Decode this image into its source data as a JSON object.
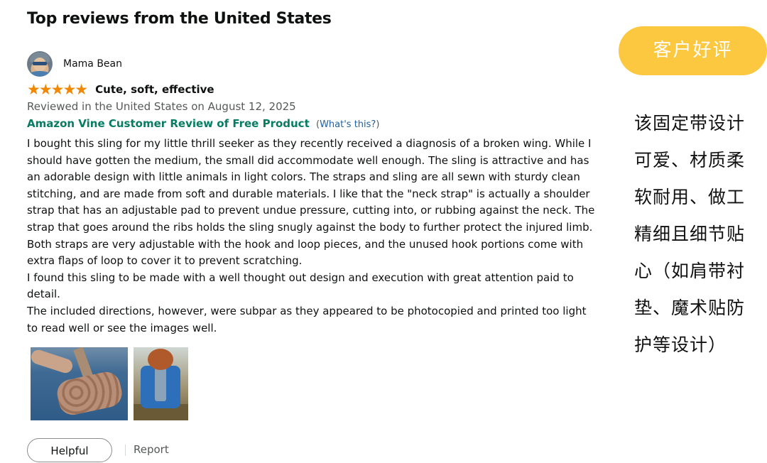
{
  "section_title": "Top reviews from the United States",
  "review": {
    "reviewer_name": "Mama Bean",
    "rating": 5,
    "stars": "★★★★★",
    "title": "Cute, soft, effective",
    "date_line": "Reviewed in the United States on August 12, 2025",
    "vine_label": "Amazon Vine Customer Review of Free Product",
    "whats_this_open": "(",
    "whats_this": "What's this?",
    "whats_this_close": ")",
    "paragraphs": [
      "I bought this sling for my little thrill seeker as they recently received a diagnosis of a broken wing. While I should have gotten the medium, the small did accommodate well enough. The sling is attractive and has an adorable design with little animals in light colors. The straps and sling are all sewn with sturdy clean stitching, and are made from soft and durable materials. I like that the \"neck strap\" is actually a shoulder strap that has an adjustable pad to prevent undue pressure, cutting into, or rubbing against the neck. The strap that goes around the ribs holds the sling snugly against the body to further protect the injured limb. Both straps are very adjustable with the hook and loop pieces, and the unused hook portions come with extra flaps of loop to cover it to prevent scratching.",
      "I found this sling to be made with a well thought out design and execution with great attention paid to detail.",
      "The included directions, however, were subpar as they appeared to be photocopied and printed too light to read well or see the images well."
    ],
    "helpful_label": "Helpful",
    "report_label": "Report"
  },
  "side_panel": {
    "badge_label": "客户好评",
    "summary": "该固定带设计可爱、材质柔软耐用、做工精细且细节贴心（如肩带衬垫、魔术贴防护等设计）"
  },
  "colors": {
    "star": "#f08804",
    "vine_green": "#067d62",
    "link_blue": "#2162a1",
    "badge_yellow": "#fcc83f"
  }
}
